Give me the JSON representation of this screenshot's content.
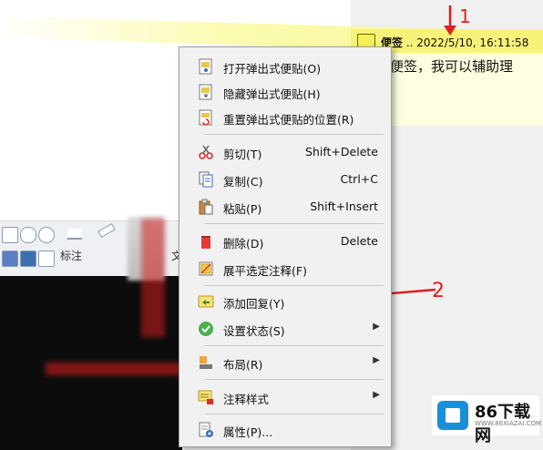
{
  "note": {
    "title_bold": "便签",
    "title_rest": " .. 2022/5/10, 16:11:58",
    "body": "便签，我可以辅助理"
  },
  "toolbar": {
    "label": "标注",
    "label2": "文"
  },
  "annotations": {
    "one": "1",
    "two": "2"
  },
  "menu": {
    "items": [
      {
        "label": "打开弹出式便贴(O)",
        "shortcut": "",
        "icon": "note-open-icon"
      },
      {
        "label": "隐藏弹出式便贴(H)",
        "shortcut": "",
        "icon": "note-hide-icon"
      },
      {
        "label": "重置弹出式便贴的位置(R)",
        "shortcut": "",
        "icon": "note-reset-icon"
      },
      {
        "label": "剪切(T)",
        "shortcut": "Shift+Delete",
        "icon": "scissors-icon"
      },
      {
        "label": "复制(C)",
        "shortcut": "Ctrl+C",
        "icon": "copy-icon"
      },
      {
        "label": "粘贴(P)",
        "shortcut": "Shift+Insert",
        "icon": "paste-icon"
      },
      {
        "label": "删除(D)",
        "shortcut": "Delete",
        "icon": "trash-icon"
      },
      {
        "label": "展平选定注释(F)",
        "shortcut": "",
        "icon": "flatten-icon"
      },
      {
        "label": "添加回复(Y)",
        "shortcut": "",
        "icon": "reply-icon"
      },
      {
        "label": "设置状态(S)",
        "shortcut": "",
        "icon": "status-check-icon"
      },
      {
        "label": "布局(R)",
        "shortcut": "",
        "icon": "layout-icon"
      },
      {
        "label": "注释样式",
        "shortcut": "",
        "icon": "annotation-style-icon"
      },
      {
        "label": "属性(P)...",
        "shortcut": "",
        "icon": "properties-icon"
      }
    ],
    "submenu_glyph": "▶"
  },
  "watermark": {
    "name": "86下载网",
    "url": "WWW.86XIAZAI.COM"
  },
  "colors": {
    "note_header": "#f7f37a",
    "note_body": "#fffee0",
    "menu_bg": "#f1f1f1",
    "annotation_red": "#e02020",
    "status_green": "#4caf50",
    "delete_red": "#e53935"
  }
}
